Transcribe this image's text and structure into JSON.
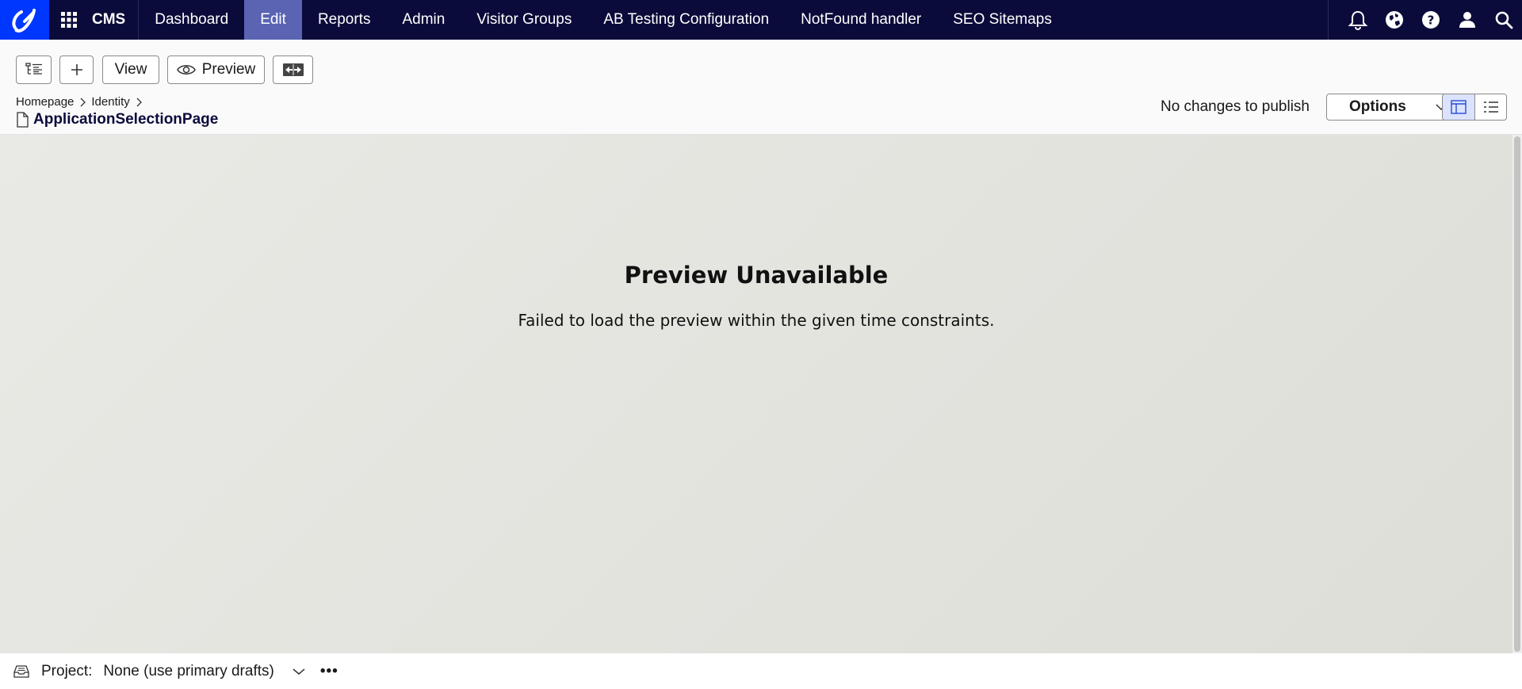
{
  "nav": {
    "app_name": "CMS",
    "items": [
      {
        "label": "Dashboard"
      },
      {
        "label": "Edit"
      },
      {
        "label": "Reports"
      },
      {
        "label": "Admin"
      },
      {
        "label": "Visitor Groups"
      },
      {
        "label": "AB Testing Configuration"
      },
      {
        "label": "NotFound handler"
      },
      {
        "label": "SEO Sitemaps"
      }
    ],
    "active_item": "Edit",
    "icons": [
      "bell-icon",
      "globe-icon",
      "help-icon",
      "user-icon",
      "search-icon"
    ]
  },
  "toolbar": {
    "view_label": "View",
    "preview_label": "Preview",
    "breadcrumb": [
      "Homepage",
      "Identity"
    ],
    "page_title": "ApplicationSelectionPage",
    "publish_status": "No changes to publish",
    "options_label": "Options"
  },
  "preview": {
    "title": "Preview Unavailable",
    "message": "Failed to load the preview within the given time constraints."
  },
  "project": {
    "label": "Project:",
    "value": "None (use primary drafts)",
    "more": "•••"
  },
  "colors": {
    "nav_bg": "#0b0b3b",
    "logo_bg": "#0037ff",
    "active_tab": "#5a64b3",
    "toggle_active": "#dbe3ff"
  }
}
